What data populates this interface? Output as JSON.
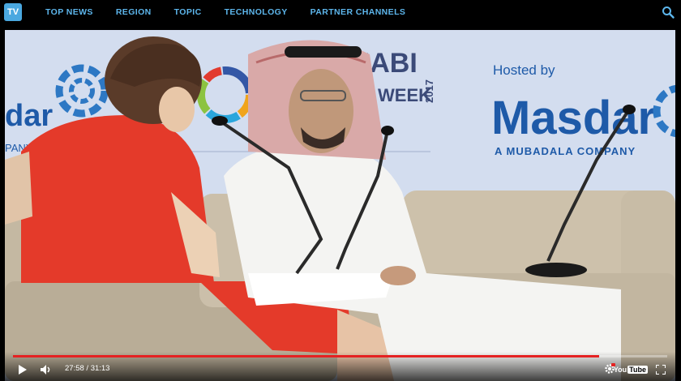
{
  "topbar": {
    "logo_text": "TV",
    "nav": [
      "TOP NEWS",
      "REGION",
      "TOPIC",
      "TECHNOLOGY",
      "PARTNER CHANNELS"
    ]
  },
  "backdrop": {
    "event_name": "ABU DHABI",
    "event_sub": "WEEK",
    "event_year": "2017",
    "hosted_by": "Hosted by",
    "host": "Masdar",
    "host_tagline": "A MUBADALA COMPANY",
    "left_partial_brand": "dar",
    "left_partial_tagline": "PANY",
    "right_partial_year": "017"
  },
  "player": {
    "time": "27:58 / 31:13",
    "progress": 0.896,
    "youtube_label": "You",
    "youtube_box": "Tube"
  },
  "colors": {
    "nav": "#5db6ec",
    "masdar": "#1e5aa8",
    "dress": "#e43a2a",
    "progress": "#e52222"
  }
}
